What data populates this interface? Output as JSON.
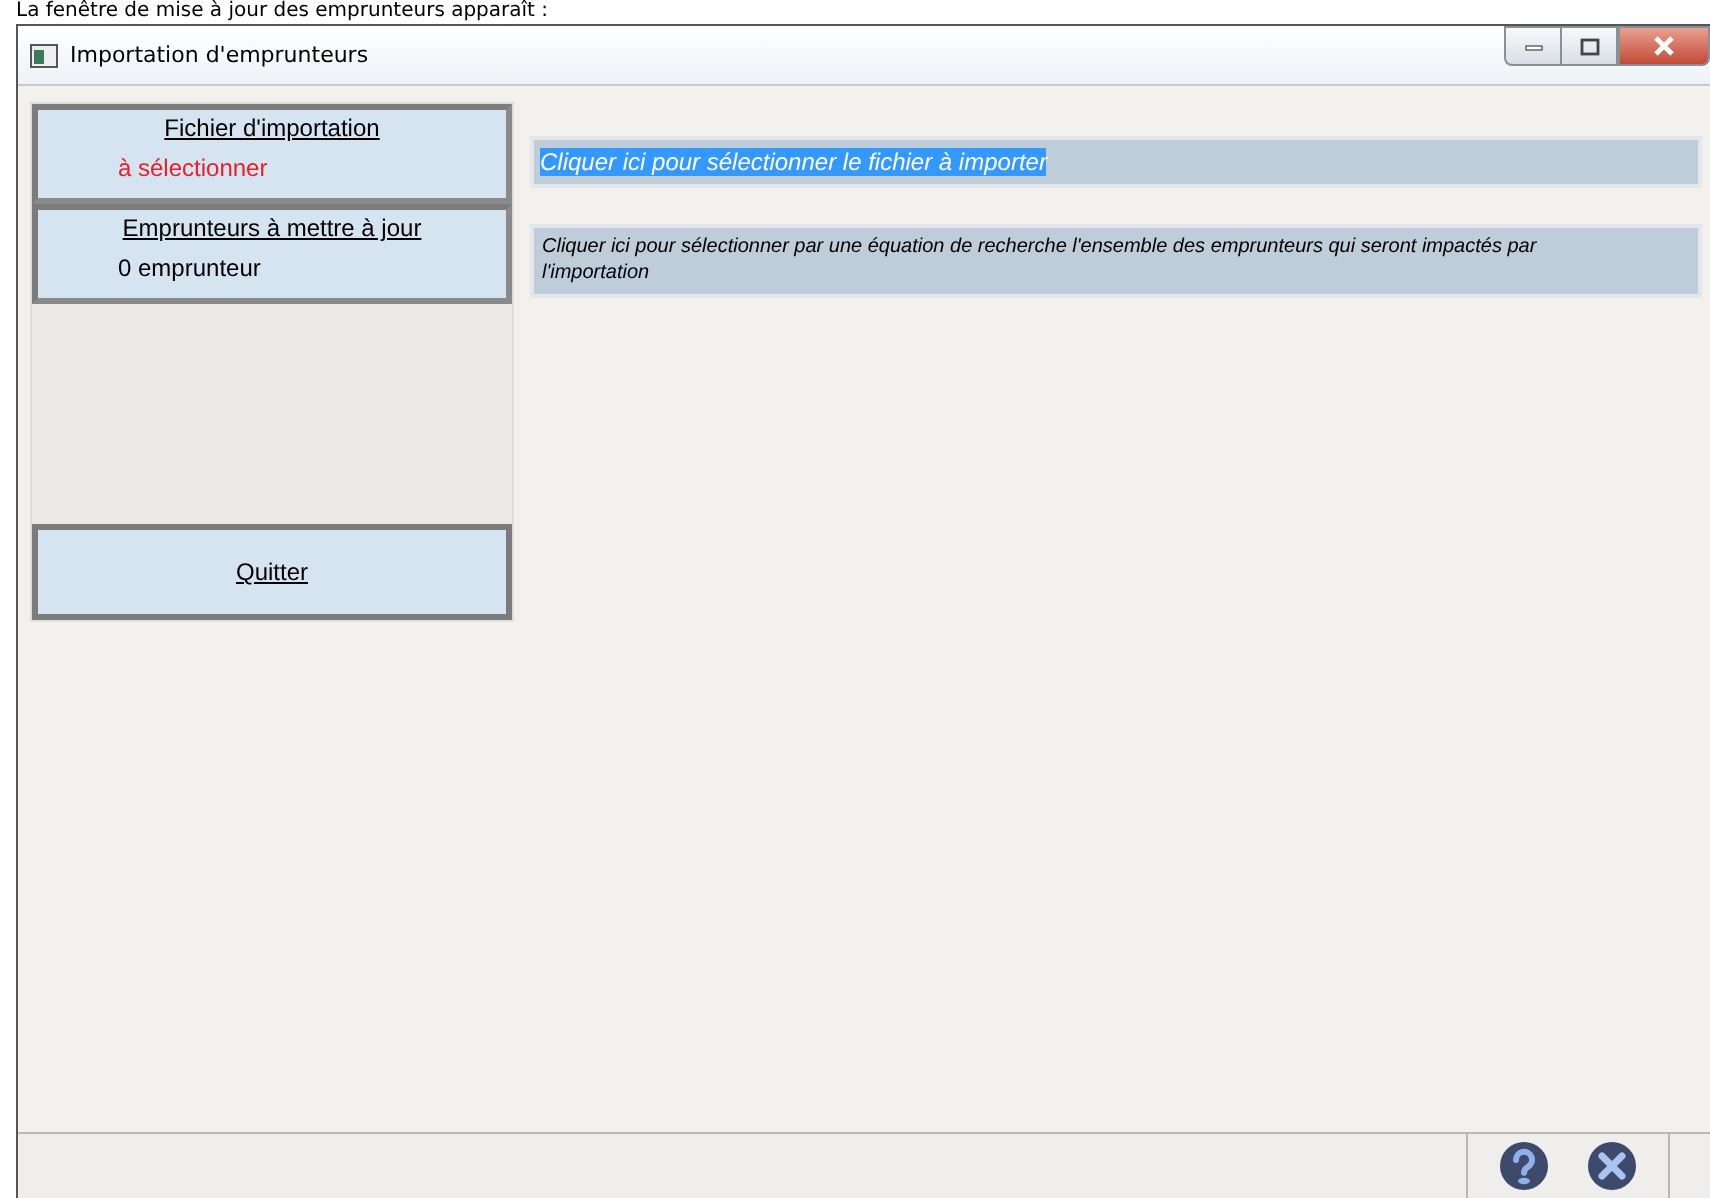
{
  "caption": "La fenêtre de mise à jour des emprunteurs apparaît :",
  "window": {
    "title": "Importation d'emprunteurs"
  },
  "sidebar": {
    "panels": [
      {
        "title": "Fichier d'importation",
        "value": "à sélectionner",
        "color": "#e8202a"
      },
      {
        "title": "Emprunteurs à mettre à jour",
        "value": "0 emprunteur",
        "color": "#000000"
      }
    ],
    "quit_button": "Quitter"
  },
  "actions": [
    {
      "text": "Cliquer ici pour sélectionner le fichier à importer",
      "highlighted": true
    },
    {
      "text": "Cliquer ici pour sélectionner par une équation de recherche l'ensemble des emprunteurs qui seront impactés par l'importation",
      "highlighted": false
    }
  ]
}
